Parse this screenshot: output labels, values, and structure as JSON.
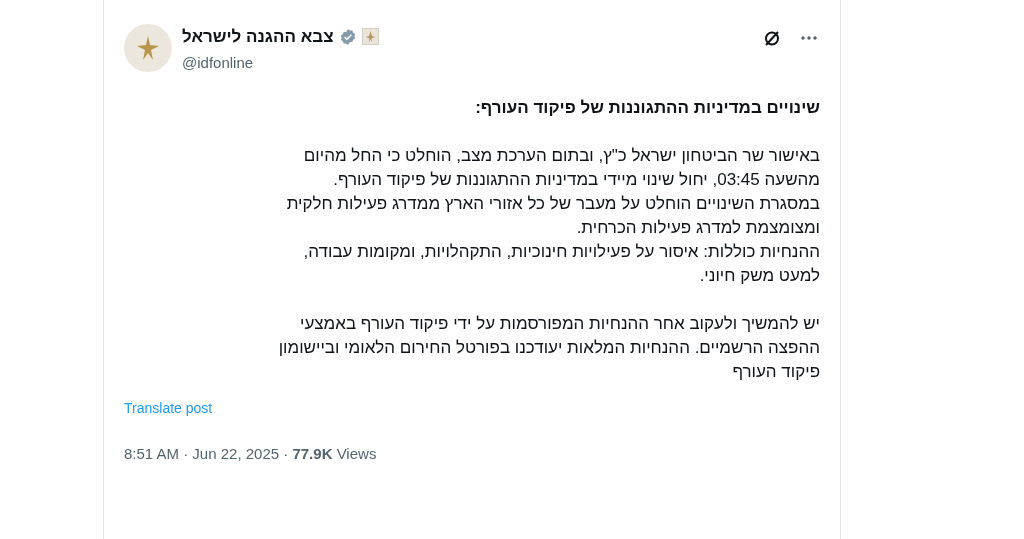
{
  "author": {
    "name": "צבא ההגנה לישראל",
    "verified": true,
    "handle": "@idfonline"
  },
  "post": {
    "title": "שינויים במדיניות ההתגוננות של פיקוד העורף:",
    "paragraphs": [
      {
        "lines": [
          "באישור שר הביטחון ישראל כ\"ץ, ובתום הערכת מצב, הוחלט כי החל מהיום",
          "מהשעה 03:45, יחול שינוי מיידי במדיניות ההתגוננות של פיקוד העורף.",
          "במסגרת השינויים הוחלט על מעבר של כל אזורי הארץ ממדרג פעילות חלקית",
          "ומצומצמת למדרג פעילות הכרחית.",
          "ההנחיות כוללות: איסור על פעילויות חינוכיות, התקהלויות, ומקומות עבודה,",
          "למעט משק חיוני."
        ]
      },
      {
        "lines": [
          "יש להמשיך ולעקוב אחר ההנחיות המפורסמות על ידי פיקוד העורף באמצעי",
          "ההפצה הרשמיים. ההנחיות המלאות יעודכנו בפורטל החירום הלאומי וביישומון",
          "פיקוד העורף"
        ]
      }
    ],
    "translate_link": "Translate post",
    "meta": "8:51 AM · Jun 22, 2025 · **77.9K** Views"
  }
}
